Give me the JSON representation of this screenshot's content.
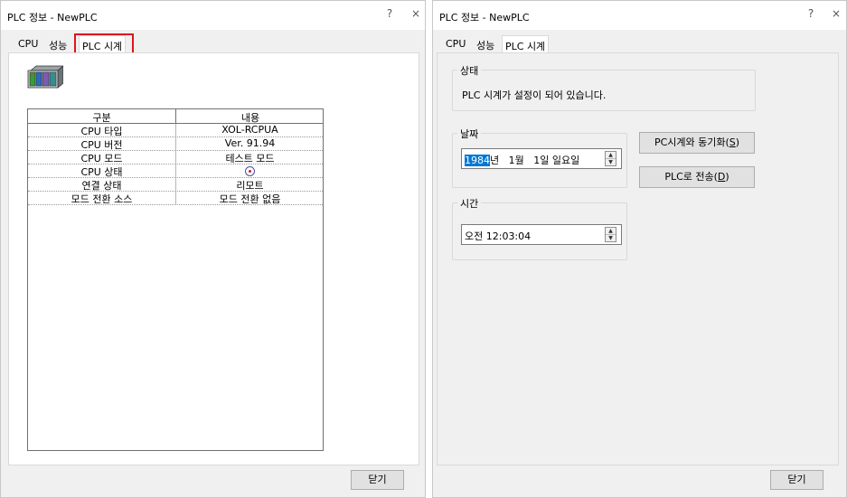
{
  "left_window": {
    "title": "PLC 정보 - NewPLC",
    "help": "?",
    "close": "×",
    "tabs": [
      "CPU",
      "성능",
      "PLC 시계"
    ],
    "table": {
      "headers": [
        "구분",
        "내용"
      ],
      "rows": [
        [
          "CPU 타입",
          "XOL-RCPUA"
        ],
        [
          "CPU 버전",
          "Ver. 91.94"
        ],
        [
          "CPU 모드",
          "테스트 모드"
        ],
        [
          "CPU 상태",
          ""
        ],
        [
          "연결 상태",
          "리모트"
        ],
        [
          "모드 전환 소스",
          "모드 전환 없음"
        ]
      ]
    },
    "close_button": "닫기"
  },
  "right_window": {
    "title": "PLC 정보 - NewPLC",
    "help": "?",
    "close": "×",
    "tabs": [
      "CPU",
      "성능",
      "PLC 시계"
    ],
    "status_group": {
      "label": "상태",
      "text": "PLC 시계가 설정이 되어 있습니다."
    },
    "date_group": {
      "label": "날짜",
      "year_selected": "1984",
      "rest": "년   1월   1일 일요일"
    },
    "time_group": {
      "label": "시간",
      "value": "오전 12:03:04"
    },
    "sync_button": {
      "label": "PC시계와 동기화(",
      "key": "S",
      "tail": ")"
    },
    "send_button": {
      "label": "PLC로 전송(",
      "key": "D",
      "tail": ")"
    },
    "close_button": "닫기"
  },
  "colors": {
    "highlight": "#e0141d",
    "selection": "#0078d7",
    "status_dot": "#d3193d"
  }
}
